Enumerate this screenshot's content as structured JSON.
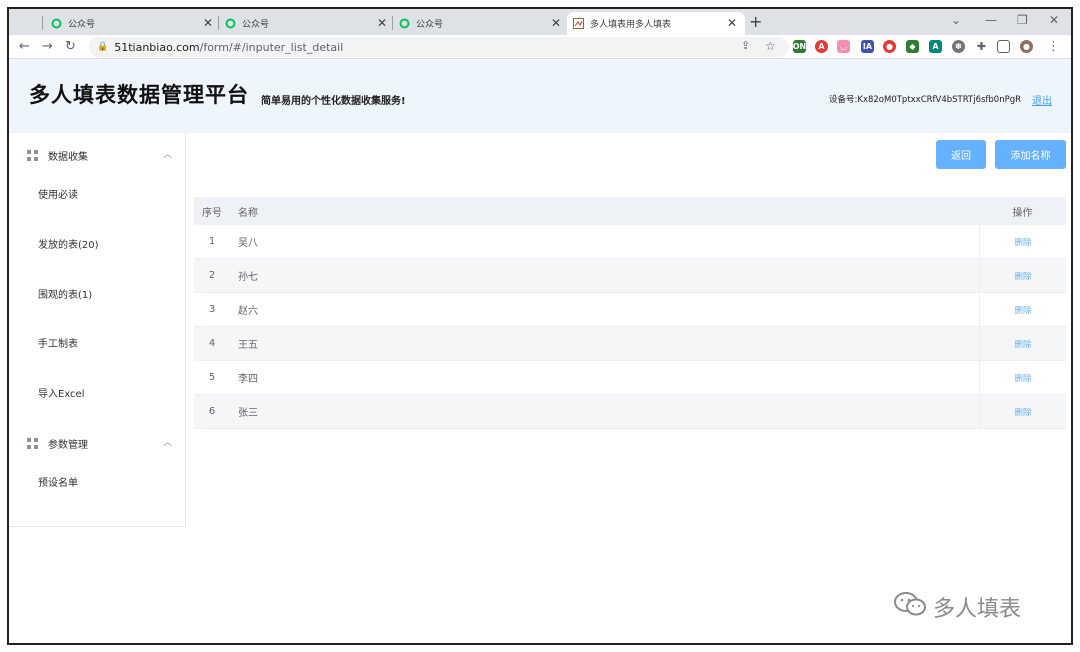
{
  "browser": {
    "tabs": [
      {
        "title": "公众号",
        "active": false
      },
      {
        "title": "公众号",
        "active": false
      },
      {
        "title": "公众号",
        "active": false
      },
      {
        "title": "多人填表用多人填表",
        "active": true
      }
    ],
    "url_host": "51tianbiao.com",
    "url_path": "/form/#/inputer_list_detail"
  },
  "header": {
    "title": "多人填表数据管理平台",
    "slogan": "简单易用的个性化数据收集服务!",
    "device_label": "设备号:Kx82oM0TptxxCRfV4bSTRTj6sfb0nPgR",
    "logout": "退出"
  },
  "sidebar": {
    "groups": [
      {
        "label": "数据收集",
        "items": [
          "使用必读",
          "发放的表(20)",
          "围观的表(1)",
          "手工制表",
          "导入Excel"
        ]
      },
      {
        "label": "参数管理",
        "items": [
          "预设名单"
        ]
      }
    ]
  },
  "toolbar": {
    "back_label": "返回",
    "add_label": "添加名称"
  },
  "table": {
    "headers": {
      "index": "序号",
      "name": "名称",
      "op": "操作"
    },
    "rows": [
      {
        "index": "1",
        "name": "吴八",
        "op": "删除"
      },
      {
        "index": "2",
        "name": "孙七",
        "op": "删除"
      },
      {
        "index": "3",
        "name": "赵六",
        "op": "删除"
      },
      {
        "index": "4",
        "name": "王五",
        "op": "删除"
      },
      {
        "index": "5",
        "name": "李四",
        "op": "删除"
      },
      {
        "index": "6",
        "name": "张三",
        "op": "删除"
      }
    ]
  },
  "watermark": "多人填表",
  "colors": {
    "primary": "#66b1ff",
    "header_bg": "#eef5fd",
    "link": "#409eff"
  }
}
